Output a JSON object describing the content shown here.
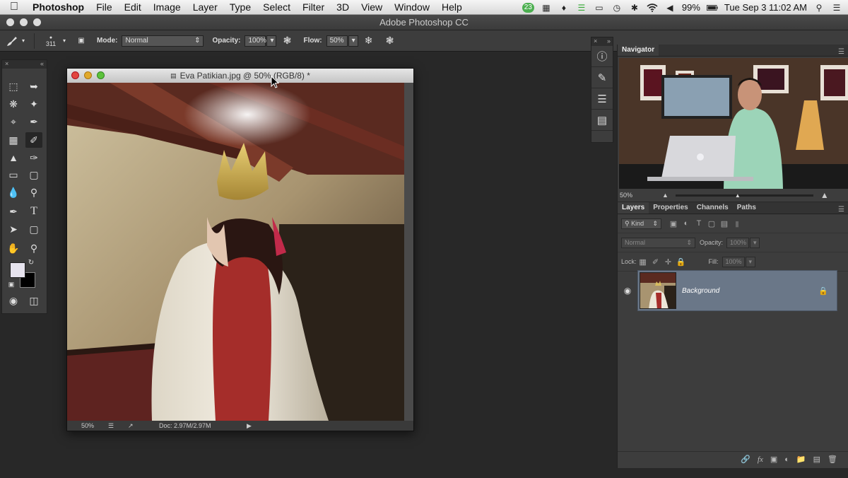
{
  "menubar": {
    "app": "Photoshop",
    "items": [
      "File",
      "Edit",
      "Image",
      "Layer",
      "Type",
      "Select",
      "Filter",
      "3D",
      "View",
      "Window",
      "Help"
    ],
    "badge": "23",
    "battery": "99%",
    "datetime": "Tue Sep 3  11:02 AM"
  },
  "app_title": "Adobe Photoshop CC",
  "options": {
    "brush_size": "311",
    "mode_label": "Mode:",
    "mode_value": "Normal",
    "opacity_label": "Opacity:",
    "opacity_value": "100%",
    "flow_label": "Flow:",
    "flow_value": "50%"
  },
  "document": {
    "title": "Eva Patikian.jpg @ 50% (RGB/8) *",
    "zoom": "50%",
    "doc_info": "Doc: 2.97M/2.97M"
  },
  "navigator": {
    "tab": "Navigator",
    "zoom": "50%"
  },
  "layers": {
    "tabs": [
      "Layers",
      "Properties",
      "Channels",
      "Paths"
    ],
    "kind_label": "Kind",
    "blend_mode": "Normal",
    "opacity_label": "Opacity:",
    "opacity_value": "100%",
    "lock_label": "Lock:",
    "fill_label": "Fill:",
    "fill_value": "100%",
    "layer_name": "Background"
  },
  "colors": {
    "foreground": "#e6e3ee",
    "background": "#000000",
    "selected_layer": "#6a7788"
  }
}
